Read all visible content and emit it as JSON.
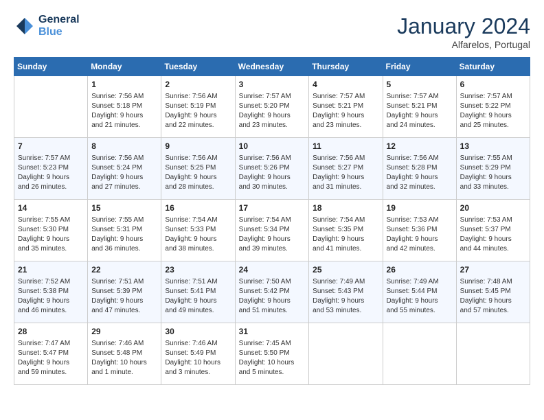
{
  "header": {
    "logo_line1": "General",
    "logo_line2": "Blue",
    "month_title": "January 2024",
    "subtitle": "Alfarelos, Portugal"
  },
  "weekdays": [
    "Sunday",
    "Monday",
    "Tuesday",
    "Wednesday",
    "Thursday",
    "Friday",
    "Saturday"
  ],
  "weeks": [
    [
      {
        "day": "",
        "info": ""
      },
      {
        "day": "1",
        "info": "Sunrise: 7:56 AM\nSunset: 5:18 PM\nDaylight: 9 hours\nand 21 minutes."
      },
      {
        "day": "2",
        "info": "Sunrise: 7:56 AM\nSunset: 5:19 PM\nDaylight: 9 hours\nand 22 minutes."
      },
      {
        "day": "3",
        "info": "Sunrise: 7:57 AM\nSunset: 5:20 PM\nDaylight: 9 hours\nand 23 minutes."
      },
      {
        "day": "4",
        "info": "Sunrise: 7:57 AM\nSunset: 5:21 PM\nDaylight: 9 hours\nand 23 minutes."
      },
      {
        "day": "5",
        "info": "Sunrise: 7:57 AM\nSunset: 5:21 PM\nDaylight: 9 hours\nand 24 minutes."
      },
      {
        "day": "6",
        "info": "Sunrise: 7:57 AM\nSunset: 5:22 PM\nDaylight: 9 hours\nand 25 minutes."
      }
    ],
    [
      {
        "day": "7",
        "info": "Sunrise: 7:57 AM\nSunset: 5:23 PM\nDaylight: 9 hours\nand 26 minutes."
      },
      {
        "day": "8",
        "info": "Sunrise: 7:56 AM\nSunset: 5:24 PM\nDaylight: 9 hours\nand 27 minutes."
      },
      {
        "day": "9",
        "info": "Sunrise: 7:56 AM\nSunset: 5:25 PM\nDaylight: 9 hours\nand 28 minutes."
      },
      {
        "day": "10",
        "info": "Sunrise: 7:56 AM\nSunset: 5:26 PM\nDaylight: 9 hours\nand 30 minutes."
      },
      {
        "day": "11",
        "info": "Sunrise: 7:56 AM\nSunset: 5:27 PM\nDaylight: 9 hours\nand 31 minutes."
      },
      {
        "day": "12",
        "info": "Sunrise: 7:56 AM\nSunset: 5:28 PM\nDaylight: 9 hours\nand 32 minutes."
      },
      {
        "day": "13",
        "info": "Sunrise: 7:55 AM\nSunset: 5:29 PM\nDaylight: 9 hours\nand 33 minutes."
      }
    ],
    [
      {
        "day": "14",
        "info": "Sunrise: 7:55 AM\nSunset: 5:30 PM\nDaylight: 9 hours\nand 35 minutes."
      },
      {
        "day": "15",
        "info": "Sunrise: 7:55 AM\nSunset: 5:31 PM\nDaylight: 9 hours\nand 36 minutes."
      },
      {
        "day": "16",
        "info": "Sunrise: 7:54 AM\nSunset: 5:33 PM\nDaylight: 9 hours\nand 38 minutes."
      },
      {
        "day": "17",
        "info": "Sunrise: 7:54 AM\nSunset: 5:34 PM\nDaylight: 9 hours\nand 39 minutes."
      },
      {
        "day": "18",
        "info": "Sunrise: 7:54 AM\nSunset: 5:35 PM\nDaylight: 9 hours\nand 41 minutes."
      },
      {
        "day": "19",
        "info": "Sunrise: 7:53 AM\nSunset: 5:36 PM\nDaylight: 9 hours\nand 42 minutes."
      },
      {
        "day": "20",
        "info": "Sunrise: 7:53 AM\nSunset: 5:37 PM\nDaylight: 9 hours\nand 44 minutes."
      }
    ],
    [
      {
        "day": "21",
        "info": "Sunrise: 7:52 AM\nSunset: 5:38 PM\nDaylight: 9 hours\nand 46 minutes."
      },
      {
        "day": "22",
        "info": "Sunrise: 7:51 AM\nSunset: 5:39 PM\nDaylight: 9 hours\nand 47 minutes."
      },
      {
        "day": "23",
        "info": "Sunrise: 7:51 AM\nSunset: 5:41 PM\nDaylight: 9 hours\nand 49 minutes."
      },
      {
        "day": "24",
        "info": "Sunrise: 7:50 AM\nSunset: 5:42 PM\nDaylight: 9 hours\nand 51 minutes."
      },
      {
        "day": "25",
        "info": "Sunrise: 7:49 AM\nSunset: 5:43 PM\nDaylight: 9 hours\nand 53 minutes."
      },
      {
        "day": "26",
        "info": "Sunrise: 7:49 AM\nSunset: 5:44 PM\nDaylight: 9 hours\nand 55 minutes."
      },
      {
        "day": "27",
        "info": "Sunrise: 7:48 AM\nSunset: 5:45 PM\nDaylight: 9 hours\nand 57 minutes."
      }
    ],
    [
      {
        "day": "28",
        "info": "Sunrise: 7:47 AM\nSunset: 5:47 PM\nDaylight: 9 hours\nand 59 minutes."
      },
      {
        "day": "29",
        "info": "Sunrise: 7:46 AM\nSunset: 5:48 PM\nDaylight: 10 hours\nand 1 minute."
      },
      {
        "day": "30",
        "info": "Sunrise: 7:46 AM\nSunset: 5:49 PM\nDaylight: 10 hours\nand 3 minutes."
      },
      {
        "day": "31",
        "info": "Sunrise: 7:45 AM\nSunset: 5:50 PM\nDaylight: 10 hours\nand 5 minutes."
      },
      {
        "day": "",
        "info": ""
      },
      {
        "day": "",
        "info": ""
      },
      {
        "day": "",
        "info": ""
      }
    ]
  ]
}
